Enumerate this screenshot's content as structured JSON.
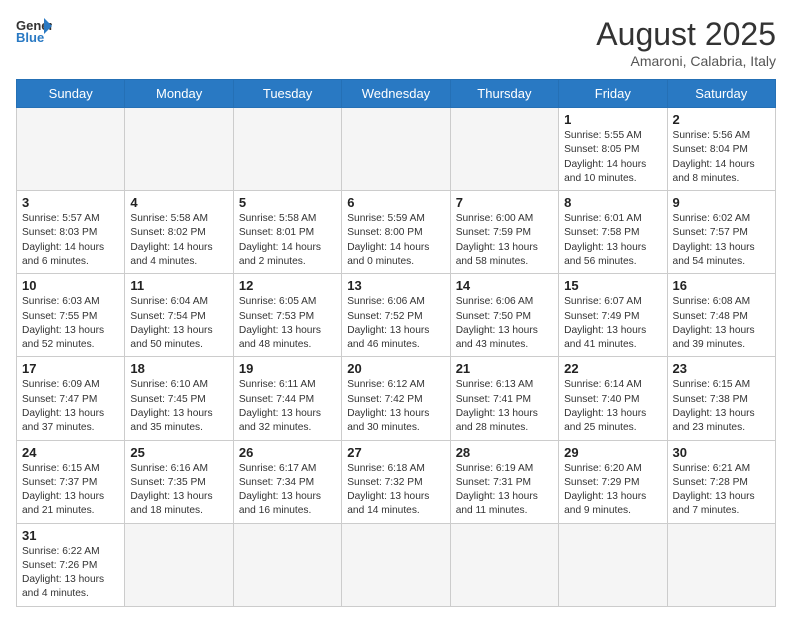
{
  "header": {
    "logo_general": "General",
    "logo_blue": "Blue",
    "month_year": "August 2025",
    "location": "Amaroni, Calabria, Italy"
  },
  "weekdays": [
    "Sunday",
    "Monday",
    "Tuesday",
    "Wednesday",
    "Thursday",
    "Friday",
    "Saturday"
  ],
  "weeks": [
    [
      {
        "day": "",
        "info": ""
      },
      {
        "day": "",
        "info": ""
      },
      {
        "day": "",
        "info": ""
      },
      {
        "day": "",
        "info": ""
      },
      {
        "day": "",
        "info": ""
      },
      {
        "day": "1",
        "info": "Sunrise: 5:55 AM\nSunset: 8:05 PM\nDaylight: 14 hours and 10 minutes."
      },
      {
        "day": "2",
        "info": "Sunrise: 5:56 AM\nSunset: 8:04 PM\nDaylight: 14 hours and 8 minutes."
      }
    ],
    [
      {
        "day": "3",
        "info": "Sunrise: 5:57 AM\nSunset: 8:03 PM\nDaylight: 14 hours and 6 minutes."
      },
      {
        "day": "4",
        "info": "Sunrise: 5:58 AM\nSunset: 8:02 PM\nDaylight: 14 hours and 4 minutes."
      },
      {
        "day": "5",
        "info": "Sunrise: 5:58 AM\nSunset: 8:01 PM\nDaylight: 14 hours and 2 minutes."
      },
      {
        "day": "6",
        "info": "Sunrise: 5:59 AM\nSunset: 8:00 PM\nDaylight: 14 hours and 0 minutes."
      },
      {
        "day": "7",
        "info": "Sunrise: 6:00 AM\nSunset: 7:59 PM\nDaylight: 13 hours and 58 minutes."
      },
      {
        "day": "8",
        "info": "Sunrise: 6:01 AM\nSunset: 7:58 PM\nDaylight: 13 hours and 56 minutes."
      },
      {
        "day": "9",
        "info": "Sunrise: 6:02 AM\nSunset: 7:57 PM\nDaylight: 13 hours and 54 minutes."
      }
    ],
    [
      {
        "day": "10",
        "info": "Sunrise: 6:03 AM\nSunset: 7:55 PM\nDaylight: 13 hours and 52 minutes."
      },
      {
        "day": "11",
        "info": "Sunrise: 6:04 AM\nSunset: 7:54 PM\nDaylight: 13 hours and 50 minutes."
      },
      {
        "day": "12",
        "info": "Sunrise: 6:05 AM\nSunset: 7:53 PM\nDaylight: 13 hours and 48 minutes."
      },
      {
        "day": "13",
        "info": "Sunrise: 6:06 AM\nSunset: 7:52 PM\nDaylight: 13 hours and 46 minutes."
      },
      {
        "day": "14",
        "info": "Sunrise: 6:06 AM\nSunset: 7:50 PM\nDaylight: 13 hours and 43 minutes."
      },
      {
        "day": "15",
        "info": "Sunrise: 6:07 AM\nSunset: 7:49 PM\nDaylight: 13 hours and 41 minutes."
      },
      {
        "day": "16",
        "info": "Sunrise: 6:08 AM\nSunset: 7:48 PM\nDaylight: 13 hours and 39 minutes."
      }
    ],
    [
      {
        "day": "17",
        "info": "Sunrise: 6:09 AM\nSunset: 7:47 PM\nDaylight: 13 hours and 37 minutes."
      },
      {
        "day": "18",
        "info": "Sunrise: 6:10 AM\nSunset: 7:45 PM\nDaylight: 13 hours and 35 minutes."
      },
      {
        "day": "19",
        "info": "Sunrise: 6:11 AM\nSunset: 7:44 PM\nDaylight: 13 hours and 32 minutes."
      },
      {
        "day": "20",
        "info": "Sunrise: 6:12 AM\nSunset: 7:42 PM\nDaylight: 13 hours and 30 minutes."
      },
      {
        "day": "21",
        "info": "Sunrise: 6:13 AM\nSunset: 7:41 PM\nDaylight: 13 hours and 28 minutes."
      },
      {
        "day": "22",
        "info": "Sunrise: 6:14 AM\nSunset: 7:40 PM\nDaylight: 13 hours and 25 minutes."
      },
      {
        "day": "23",
        "info": "Sunrise: 6:15 AM\nSunset: 7:38 PM\nDaylight: 13 hours and 23 minutes."
      }
    ],
    [
      {
        "day": "24",
        "info": "Sunrise: 6:15 AM\nSunset: 7:37 PM\nDaylight: 13 hours and 21 minutes."
      },
      {
        "day": "25",
        "info": "Sunrise: 6:16 AM\nSunset: 7:35 PM\nDaylight: 13 hours and 18 minutes."
      },
      {
        "day": "26",
        "info": "Sunrise: 6:17 AM\nSunset: 7:34 PM\nDaylight: 13 hours and 16 minutes."
      },
      {
        "day": "27",
        "info": "Sunrise: 6:18 AM\nSunset: 7:32 PM\nDaylight: 13 hours and 14 minutes."
      },
      {
        "day": "28",
        "info": "Sunrise: 6:19 AM\nSunset: 7:31 PM\nDaylight: 13 hours and 11 minutes."
      },
      {
        "day": "29",
        "info": "Sunrise: 6:20 AM\nSunset: 7:29 PM\nDaylight: 13 hours and 9 minutes."
      },
      {
        "day": "30",
        "info": "Sunrise: 6:21 AM\nSunset: 7:28 PM\nDaylight: 13 hours and 7 minutes."
      }
    ],
    [
      {
        "day": "31",
        "info": "Sunrise: 6:22 AM\nSunset: 7:26 PM\nDaylight: 13 hours and 4 minutes."
      },
      {
        "day": "",
        "info": ""
      },
      {
        "day": "",
        "info": ""
      },
      {
        "day": "",
        "info": ""
      },
      {
        "day": "",
        "info": ""
      },
      {
        "day": "",
        "info": ""
      },
      {
        "day": "",
        "info": ""
      }
    ]
  ]
}
